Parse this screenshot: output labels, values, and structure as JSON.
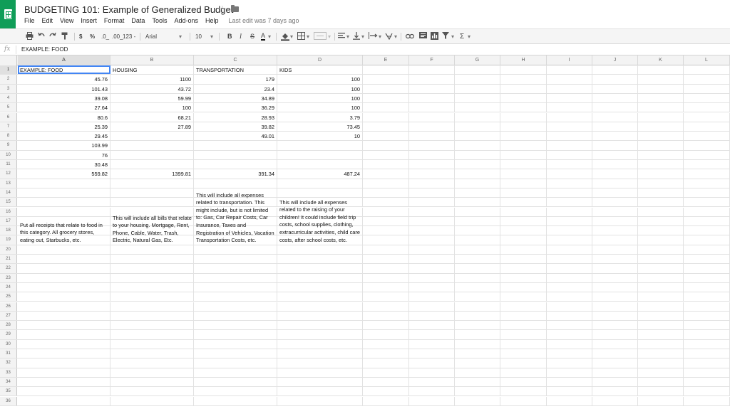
{
  "app": {
    "title": "BUDGETING 101: Example of Generalized Budget",
    "last_edit": "Last edit was 7 days ago",
    "menu": [
      "File",
      "Edit",
      "View",
      "Insert",
      "Format",
      "Data",
      "Tools",
      "Add-ons",
      "Help"
    ]
  },
  "toolbar": {
    "currency": "$",
    "percent": "%",
    "decimal_less": ".0_",
    "decimal_more": ".00_",
    "number_format": "123 -",
    "font": "Arial",
    "font_size": "10",
    "bold": "B",
    "italic": "I",
    "strike": "S",
    "text_color": "A",
    "sum": "Σ"
  },
  "formula_bar": {
    "icon": "fx",
    "content": "EXAMPLE: FOOD"
  },
  "grid": {
    "columns": [
      "A",
      "B",
      "C",
      "D",
      "E",
      "F",
      "G",
      "H",
      "I",
      "J",
      "K",
      "L"
    ],
    "selected_column": "A",
    "selected_cell": "A1",
    "row_numbers": [
      "1",
      "2",
      "3",
      "4",
      "5",
      "6",
      "7",
      "8",
      "9",
      "10",
      "11",
      "12",
      "13",
      "14",
      "15",
      "16",
      "17",
      "18",
      "19",
      "20",
      "21",
      "22",
      "23",
      "24",
      "25",
      "26",
      "27",
      "28",
      "29",
      "30",
      "31",
      "32",
      "33",
      "34",
      "35",
      "36"
    ],
    "rows": [
      {
        "A": "EXAMPLE: FOOD",
        "B": "HOUSING",
        "C": "TRANSPORTATION",
        "D": "KIDS"
      },
      {
        "A": "45.76",
        "B": "1100",
        "C": "179",
        "D": "100"
      },
      {
        "A": "101.43",
        "B": "43.72",
        "C": "23.4",
        "D": "100"
      },
      {
        "A": "39.08",
        "B": "59.99",
        "C": "34.89",
        "D": "100"
      },
      {
        "A": "27.64",
        "B": "100",
        "C": "36.29",
        "D": "100"
      },
      {
        "A": "80.6",
        "B": "68.21",
        "C": "28.93",
        "D": "3.79"
      },
      {
        "A": "25.39",
        "B": "27.89",
        "C": "39.82",
        "D": "73.45"
      },
      {
        "A": "29.45",
        "B": "",
        "C": "49.01",
        "D": "10"
      },
      {
        "A": "103.99",
        "B": "",
        "C": "",
        "D": ""
      },
      {
        "A": "76",
        "B": "",
        "C": "",
        "D": ""
      },
      {
        "A": "30.48",
        "B": "",
        "C": "",
        "D": ""
      },
      {
        "A": "559.82",
        "B": "1399.81",
        "C": "391.34",
        "D": "487.24"
      }
    ],
    "descriptions": {
      "A": "Put all receipts that relate to food in this category. All grocery stores, eating out, Starbucks, etc.",
      "B": "This will include all bills that relate to your housing. Mortgage, Rent, Phone, Cable, Water, Trash, Electric, Natural Gas, Etc.",
      "C": "This will include all expenses related to transportation. This might include, but is not limited to: Gas, Car Repair Costs, Car Insurance, Taxes and Registration of Vehicles, Vacation Transportation Costs, etc.",
      "D": "This will include all expenses related to the raising of your children! It could include field trip costs, school supplies, clothing, extracurricular activities, child care costs, after school costs, etc."
    }
  }
}
